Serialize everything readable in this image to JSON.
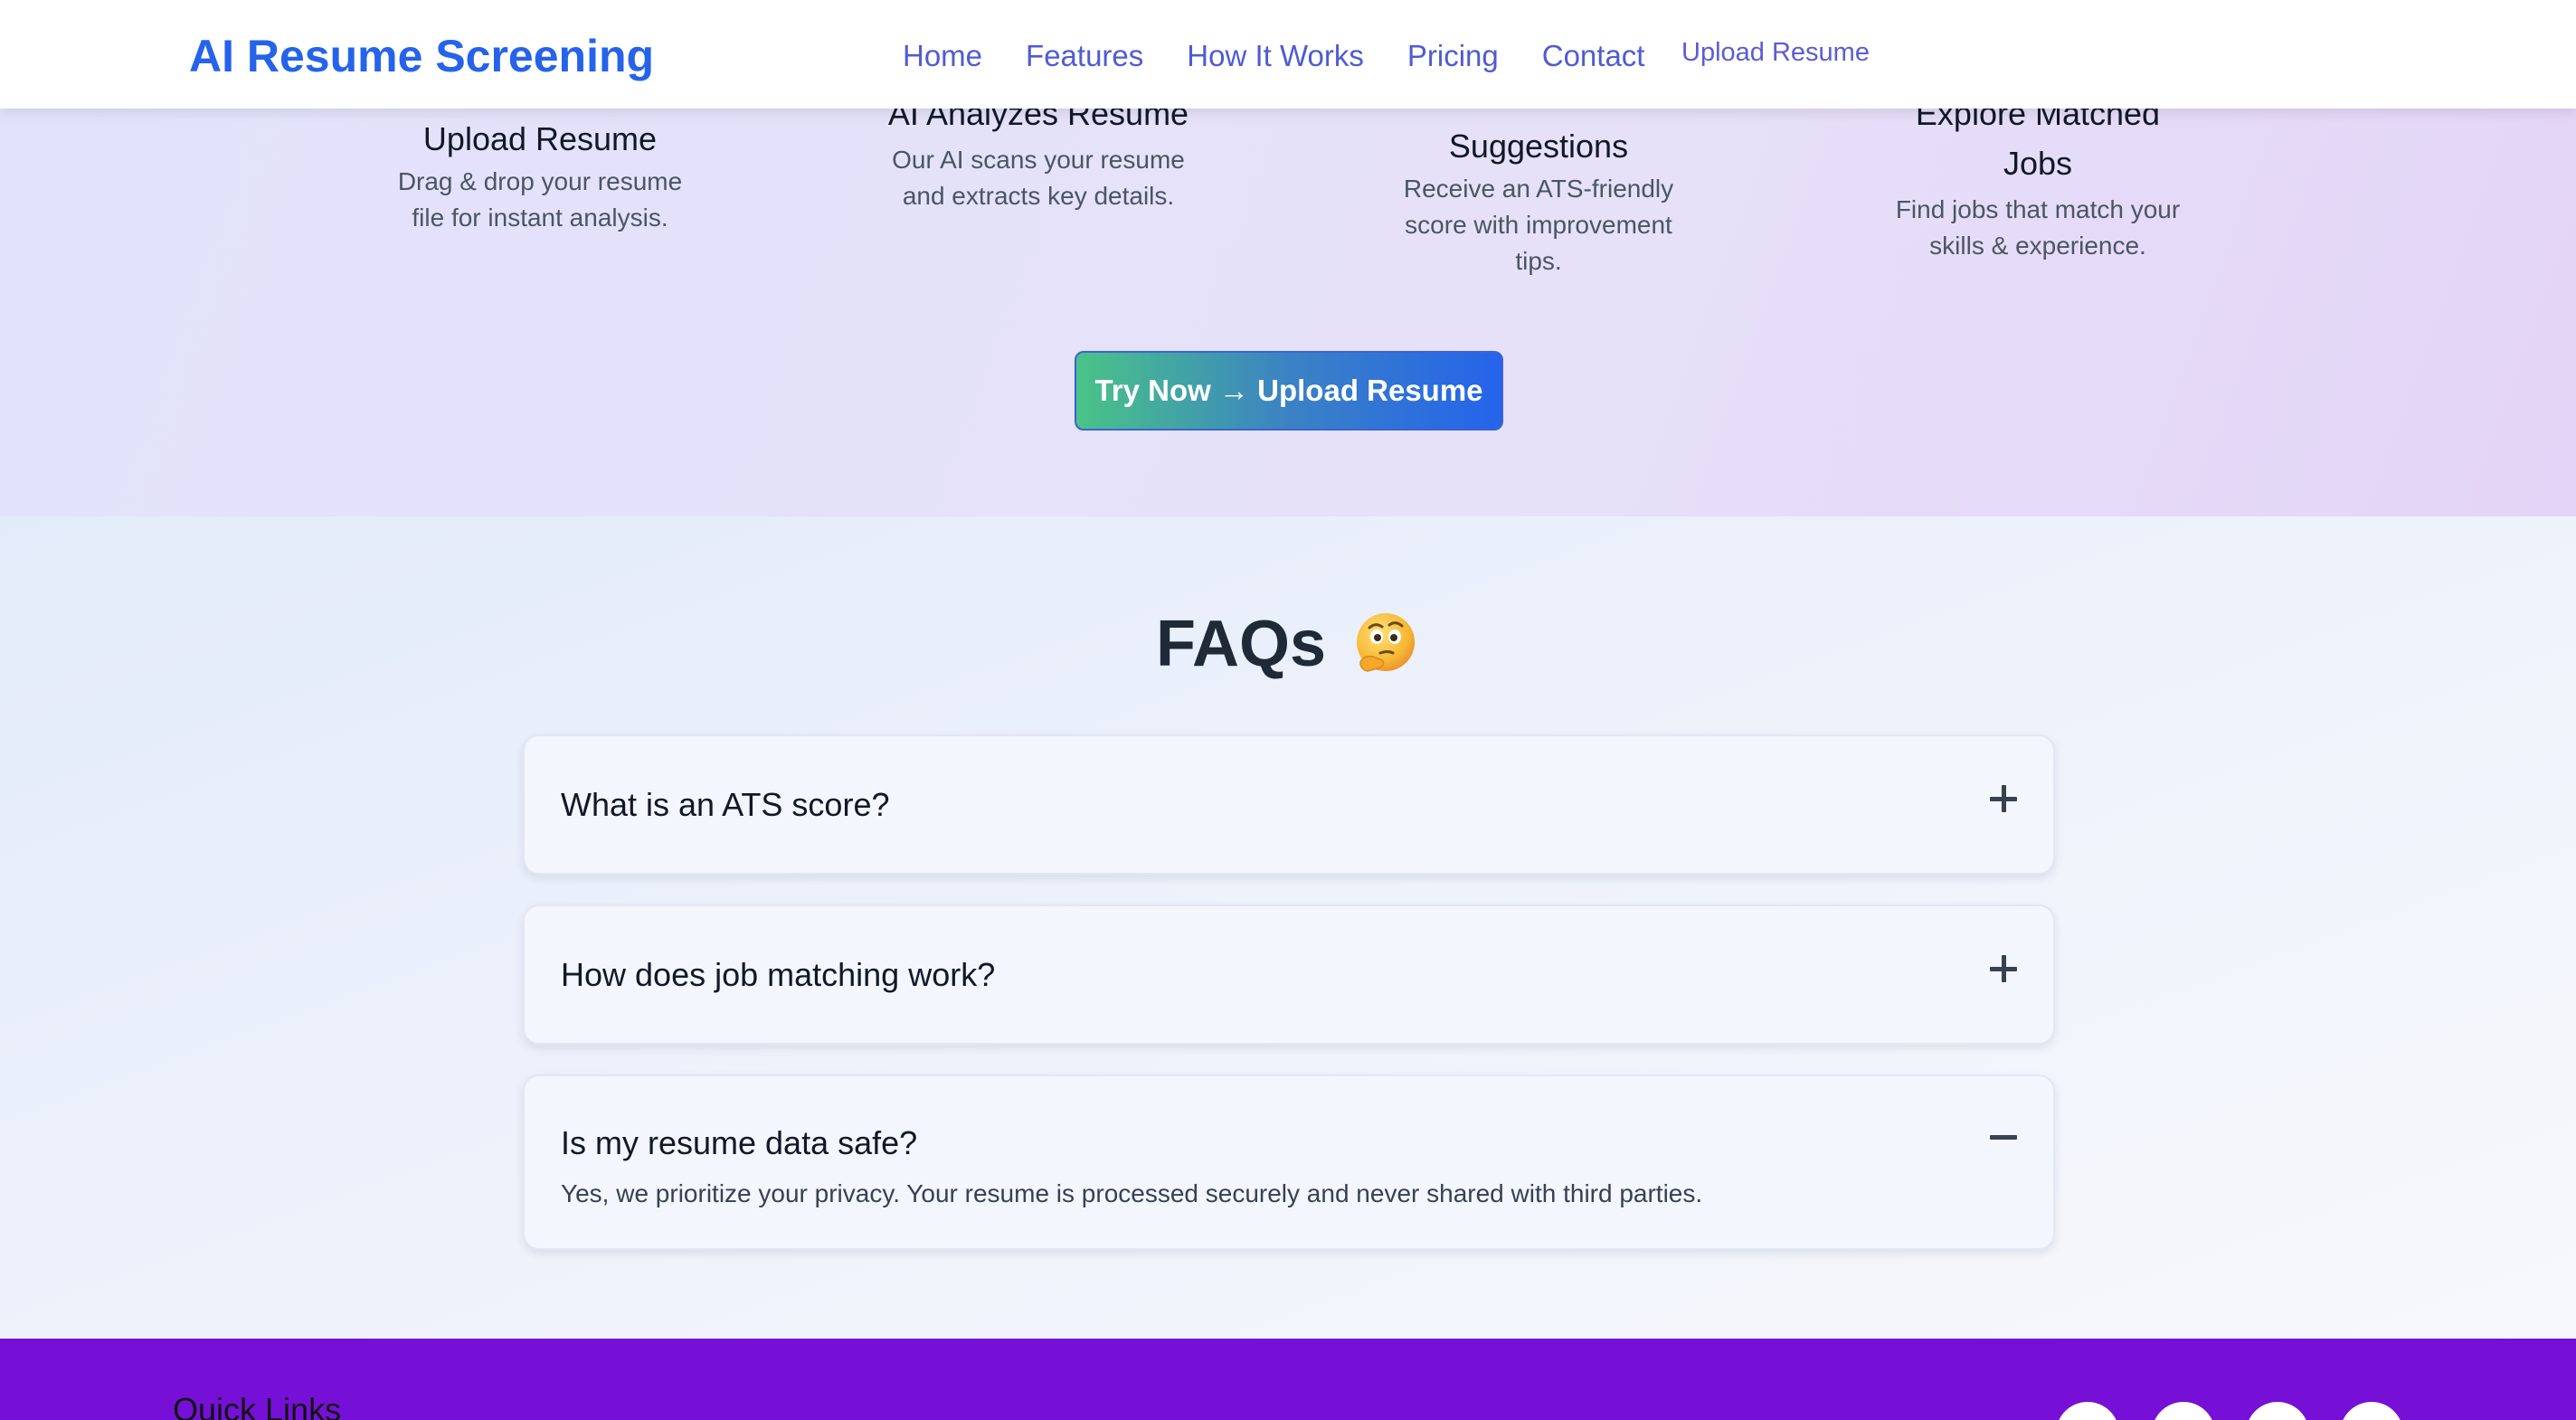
{
  "nav": {
    "brand": "AI Resume Screening",
    "links": [
      "Home",
      "Features",
      "How It Works",
      "Pricing",
      "Contact"
    ],
    "upload_link": "Upload Resume"
  },
  "steps": [
    {
      "title": "Upload Resume",
      "desc": "Drag & drop your resume file for instant analysis."
    },
    {
      "title": "AI Analyzes Resume",
      "desc": "Our AI scans your resume and extracts key details."
    },
    {
      "title": "Suggestions",
      "desc": "Receive an ATS-friendly score with improvement tips."
    },
    {
      "title": "Explore Matched Jobs",
      "desc": "Find jobs that match your skills & experience."
    }
  ],
  "cta": {
    "label": "Try Now → Upload Resume"
  },
  "faq": {
    "heading": "FAQs",
    "heading_icon": "thinking-face-emoji",
    "items": [
      {
        "question": "What is an ATS score?",
        "expanded": false,
        "answer": ""
      },
      {
        "question": "How does job matching work?",
        "expanded": false,
        "answer": ""
      },
      {
        "question": "Is my resume data safe?",
        "expanded": true,
        "answer": "Yes, we prioritize your privacy. Your resume is processed securely and never shared with third parties."
      }
    ]
  },
  "footer": {
    "quick_links_title": "Quick Links",
    "social_icons": [
      "social-icon",
      "social-icon",
      "social-icon",
      "social-icon"
    ]
  },
  "colors": {
    "brand": "#2563eb",
    "nav_link": "#4f5bd5",
    "footer_bg": "#7610d6",
    "cta_gradient_start": "#4ac387",
    "cta_gradient_end": "#2563eb"
  }
}
